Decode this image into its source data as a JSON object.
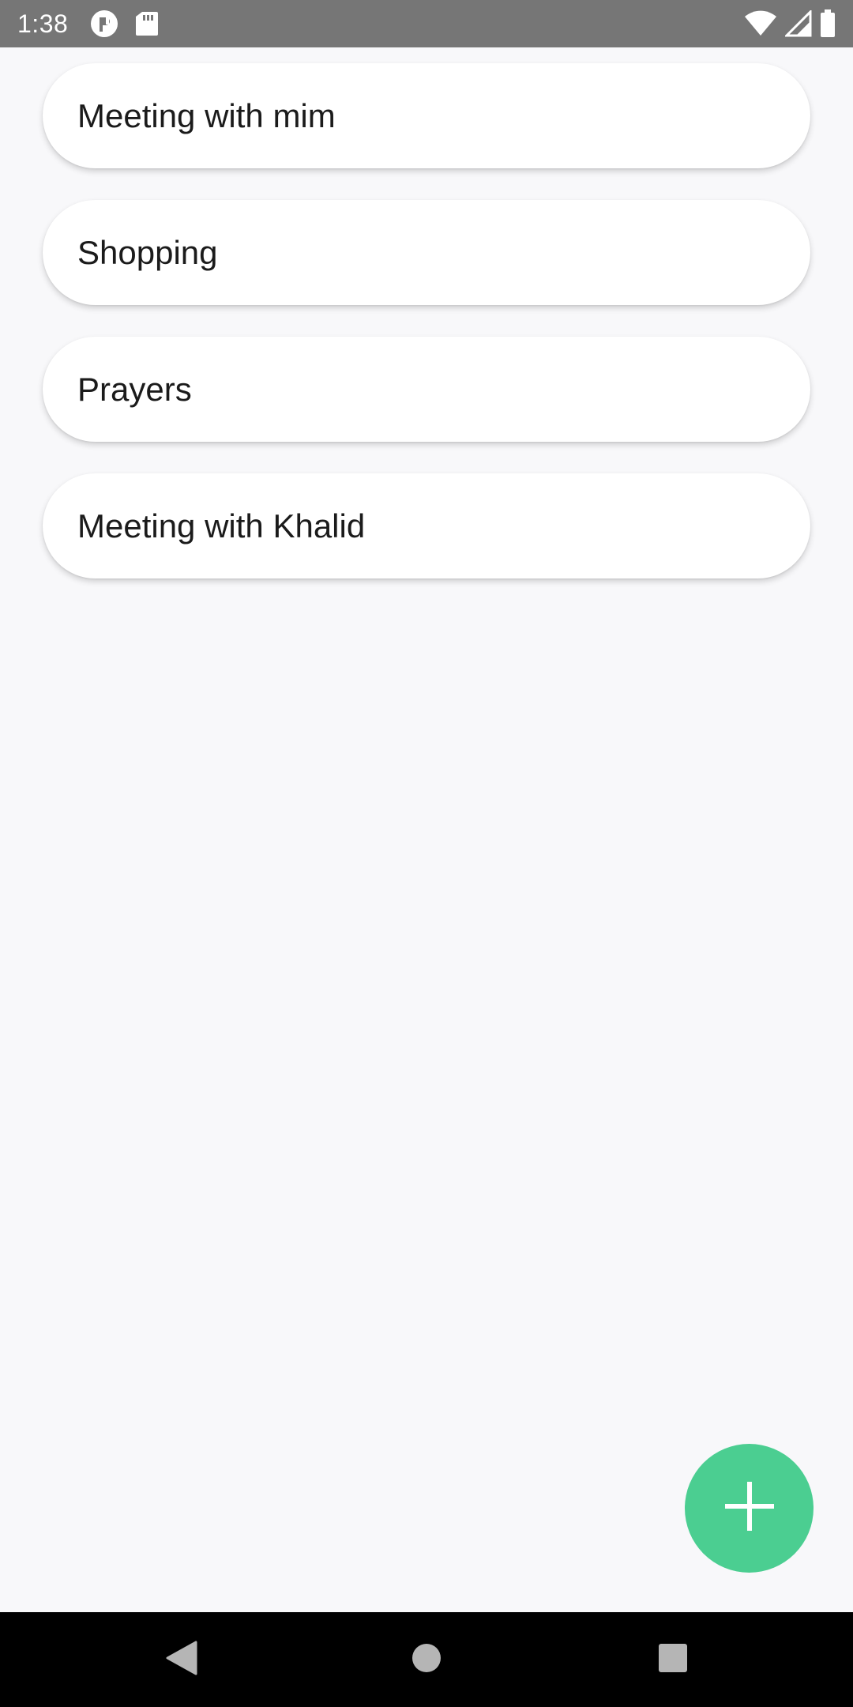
{
  "status_bar": {
    "time": "1:38",
    "left_icons": [
      "at-sign-icon",
      "sd-card-icon"
    ],
    "right_icons": [
      "wifi-icon",
      "cell-signal-icon",
      "battery-icon"
    ],
    "background": "#767676"
  },
  "tasks": [
    {
      "label": "Meeting with mim"
    },
    {
      "label": "Shopping"
    },
    {
      "label": "Prayers"
    },
    {
      "label": "Meeting with Khalid"
    }
  ],
  "fab": {
    "icon": "plus-icon",
    "color": "#4bce91"
  },
  "nav_bar": {
    "buttons": [
      "back-icon",
      "home-icon",
      "recents-icon"
    ]
  },
  "colors": {
    "background": "#f8f8fa",
    "card": "#ffffff",
    "accent": "#4bce91"
  }
}
